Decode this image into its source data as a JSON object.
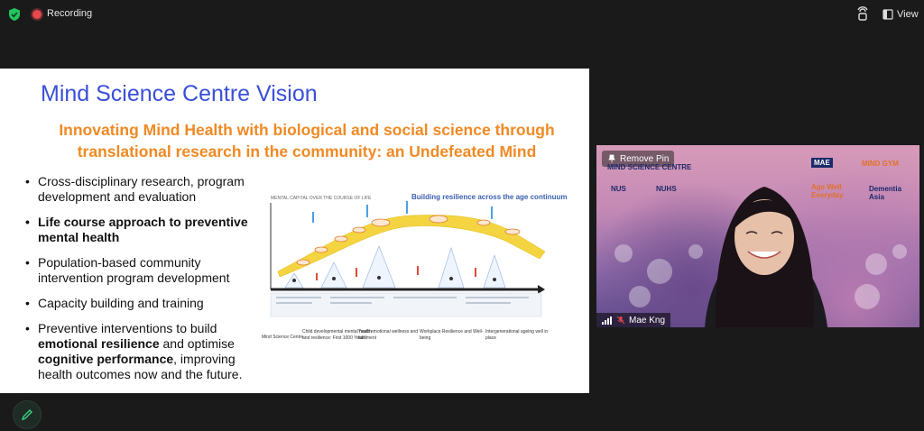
{
  "topbar": {
    "recording_label": "Recording",
    "view_label": "View"
  },
  "slide": {
    "title": "Mind Science Centre Vision",
    "subtitle_line1": "Innovating Mind Health with biological and social science through",
    "subtitle_line2": "translational research in the community: an Undefeated Mind",
    "bullets": [
      {
        "before": "Cross-disciplinary research, program development and evaluation",
        "bold": "",
        "after": ""
      },
      {
        "before": "",
        "bold": "Life course approach to preventive mental health",
        "after": ""
      },
      {
        "before": "Population-based community intervention program development",
        "bold": "",
        "after": ""
      },
      {
        "before": "Capacity building and training",
        "bold": "",
        "after": ""
      }
    ],
    "bullet5": {
      "t1": "Preventive interventions to build ",
      "b1": "emotional resilience",
      "t2": " and optimise ",
      "b2": "cognitive performance",
      "t3": ", improving health outcomes now and the future."
    },
    "diagram": {
      "title": "Building resilience across the age continuum",
      "caption": "MENTAL CAPITAL OVER THE COURSE OF LIFE",
      "footer": [
        "Mind Science Centre",
        "Child developmental mental health and resilience: First 1000 Years",
        "Youth emotional wellness and fulfilment",
        "Workplace Resilience and Well-being",
        "Intergenerational ageing well in place"
      ]
    }
  },
  "video": {
    "pin_label": "Remove Pin",
    "participant_name": "Mae Kng",
    "logos": {
      "msc": "MIND SCIENCE CENTRE",
      "nus": "NUS",
      "nuhs": "NUHS",
      "mae": "MAE",
      "mindgym": "MIND GYM",
      "ageways": "Age Well Everyday",
      "dementia": "Dementia Asia"
    }
  },
  "colors": {
    "title": "#3a4fd8",
    "subtitle": "#f08a24",
    "recording": "#e5484d",
    "shield": "#22c55e"
  }
}
